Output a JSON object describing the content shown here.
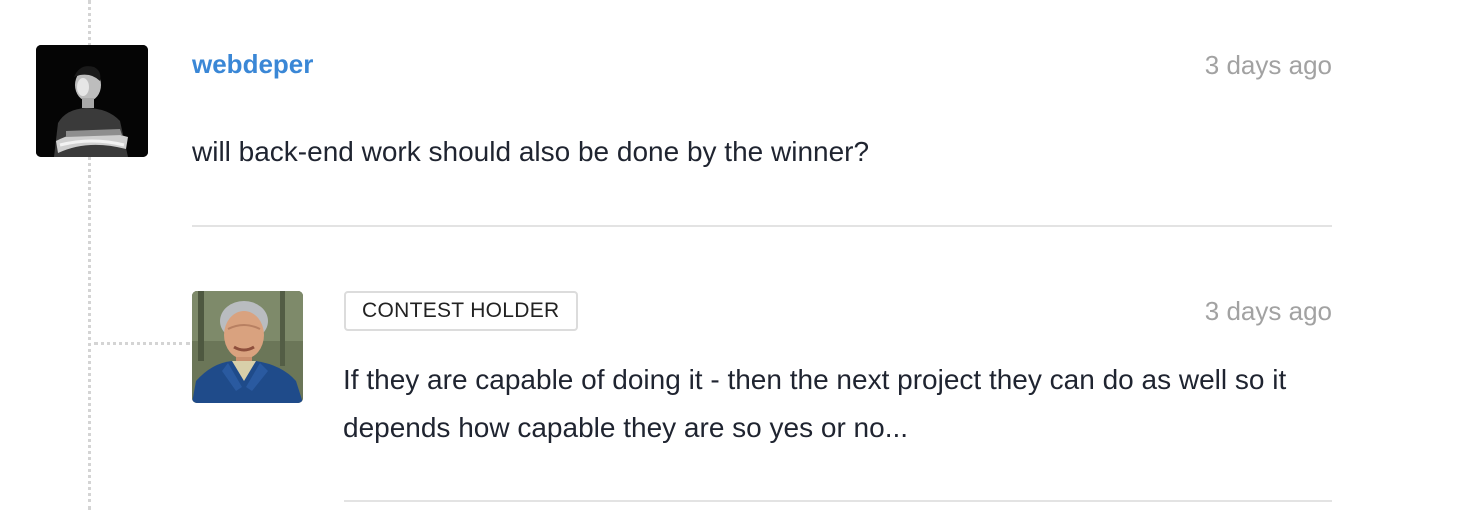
{
  "comments": [
    {
      "username": "webdeper",
      "timestamp": "3 days ago",
      "text": "will back-end work should also be done by the winner?",
      "avatar_icon": "user-avatar-icon"
    }
  ],
  "reply": {
    "badge": "CONTEST HOLDER",
    "timestamp": "3 days ago",
    "text": "If they are capable of doing it - then the next project they can do as well so it depends how capable they are so yes or no...",
    "avatar_icon": "user-avatar-icon"
  },
  "colors": {
    "username": "#3a87d6",
    "timestamp": "#a2a2a2",
    "text": "#1f2430",
    "divider": "#e3e3e3",
    "thread_line": "#d4d4d4"
  }
}
